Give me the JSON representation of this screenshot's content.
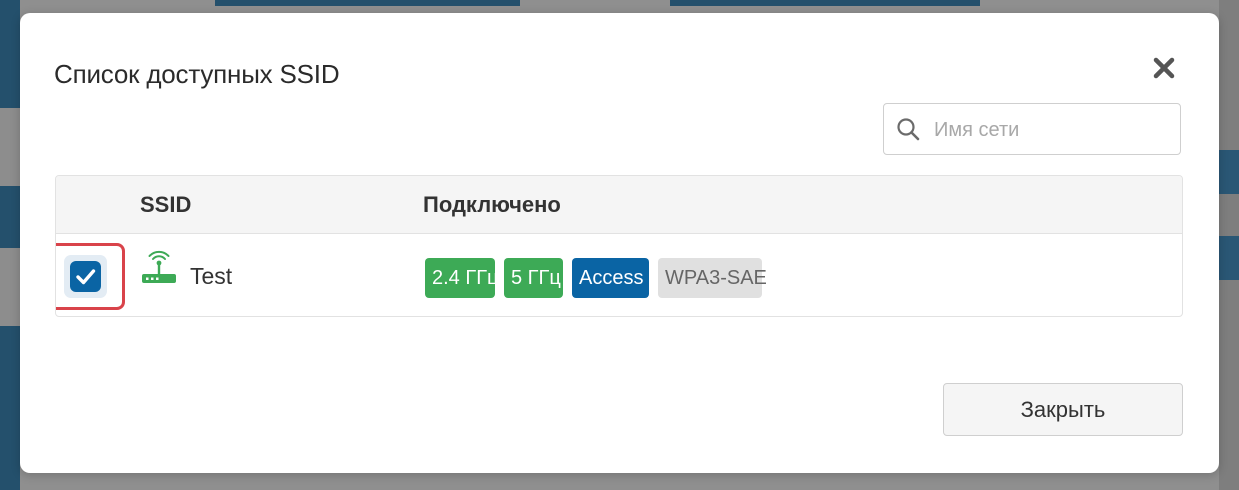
{
  "dialog": {
    "title": "Список доступных SSID",
    "close_icon": "close-icon",
    "search": {
      "placeholder": "Имя сети",
      "value": "",
      "icon": "search-icon"
    },
    "table": {
      "columns": [
        "SSID",
        "Подключено"
      ],
      "rows": [
        {
          "checked": true,
          "icon": "wifi-router-icon",
          "ssid": "Test",
          "badges": [
            "2.4 ГГц",
            "5 ГГц",
            "Access",
            "WPA3-SAE"
          ]
        }
      ]
    },
    "close_button": "Закрыть"
  },
  "colors": {
    "primary_blue": "#0a64a4",
    "band_green": "#3daa56",
    "security_gray": "#e0e0e0",
    "highlight_red": "#d9434a",
    "overlay_gray": "#8f8f8f"
  }
}
